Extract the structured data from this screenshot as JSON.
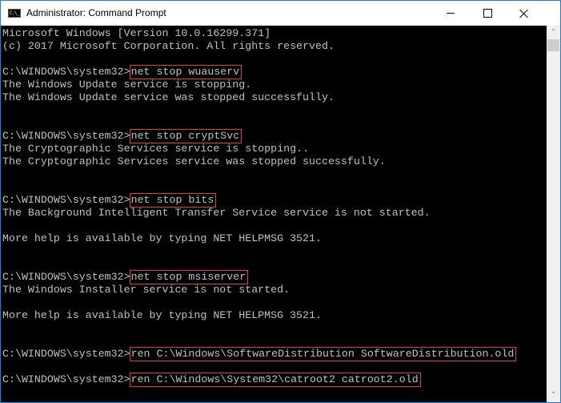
{
  "window": {
    "title": "Administrator: Command Prompt",
    "icon": "cmd-icon",
    "icon_text": "C:\\_",
    "controls": {
      "minimize": "minimize-icon",
      "maximize": "maximize-icon",
      "close": "close-icon"
    }
  },
  "console": {
    "colors": {
      "background": "#000000",
      "text": "#c0c0c0",
      "highlight": "#e23b3b"
    },
    "lines": [
      {
        "text": "Microsoft Windows [Version 10.0.16299.371]"
      },
      {
        "text": "(c) 2017 Microsoft Corporation. All rights reserved."
      },
      {
        "text": ""
      },
      {
        "prompt": "C:\\WINDOWS\\system32>",
        "command": "net stop wuauserv"
      },
      {
        "text": "The Windows Update service is stopping."
      },
      {
        "text": "The Windows Update service was stopped successfully."
      },
      {
        "text": ""
      },
      {
        "text": ""
      },
      {
        "prompt": "C:\\WINDOWS\\system32>",
        "command": "net stop cryptSvc"
      },
      {
        "text": "The Cryptographic Services service is stopping.."
      },
      {
        "text": "The Cryptographic Services service was stopped successfully."
      },
      {
        "text": ""
      },
      {
        "text": ""
      },
      {
        "prompt": "C:\\WINDOWS\\system32>",
        "command": "net stop bits"
      },
      {
        "text": "The Background Intelligent Transfer Service service is not started."
      },
      {
        "text": ""
      },
      {
        "text": "More help is available by typing NET HELPMSG 3521."
      },
      {
        "text": ""
      },
      {
        "text": ""
      },
      {
        "prompt": "C:\\WINDOWS\\system32>",
        "command": "net stop msiserver"
      },
      {
        "text": "The Windows Installer service is not started."
      },
      {
        "text": ""
      },
      {
        "text": "More help is available by typing NET HELPMSG 3521."
      },
      {
        "text": ""
      },
      {
        "text": ""
      },
      {
        "prompt": "C:\\WINDOWS\\system32>",
        "command": "ren C:\\Windows\\SoftwareDistribution SoftwareDistribution.old"
      },
      {
        "text": ""
      },
      {
        "prompt": "C:\\WINDOWS\\system32>",
        "command": "ren C:\\Windows\\System32\\catroot2 catroot2.old"
      }
    ]
  },
  "scrollbar": {
    "up_arrow": "˄",
    "down_arrow": "˅"
  }
}
